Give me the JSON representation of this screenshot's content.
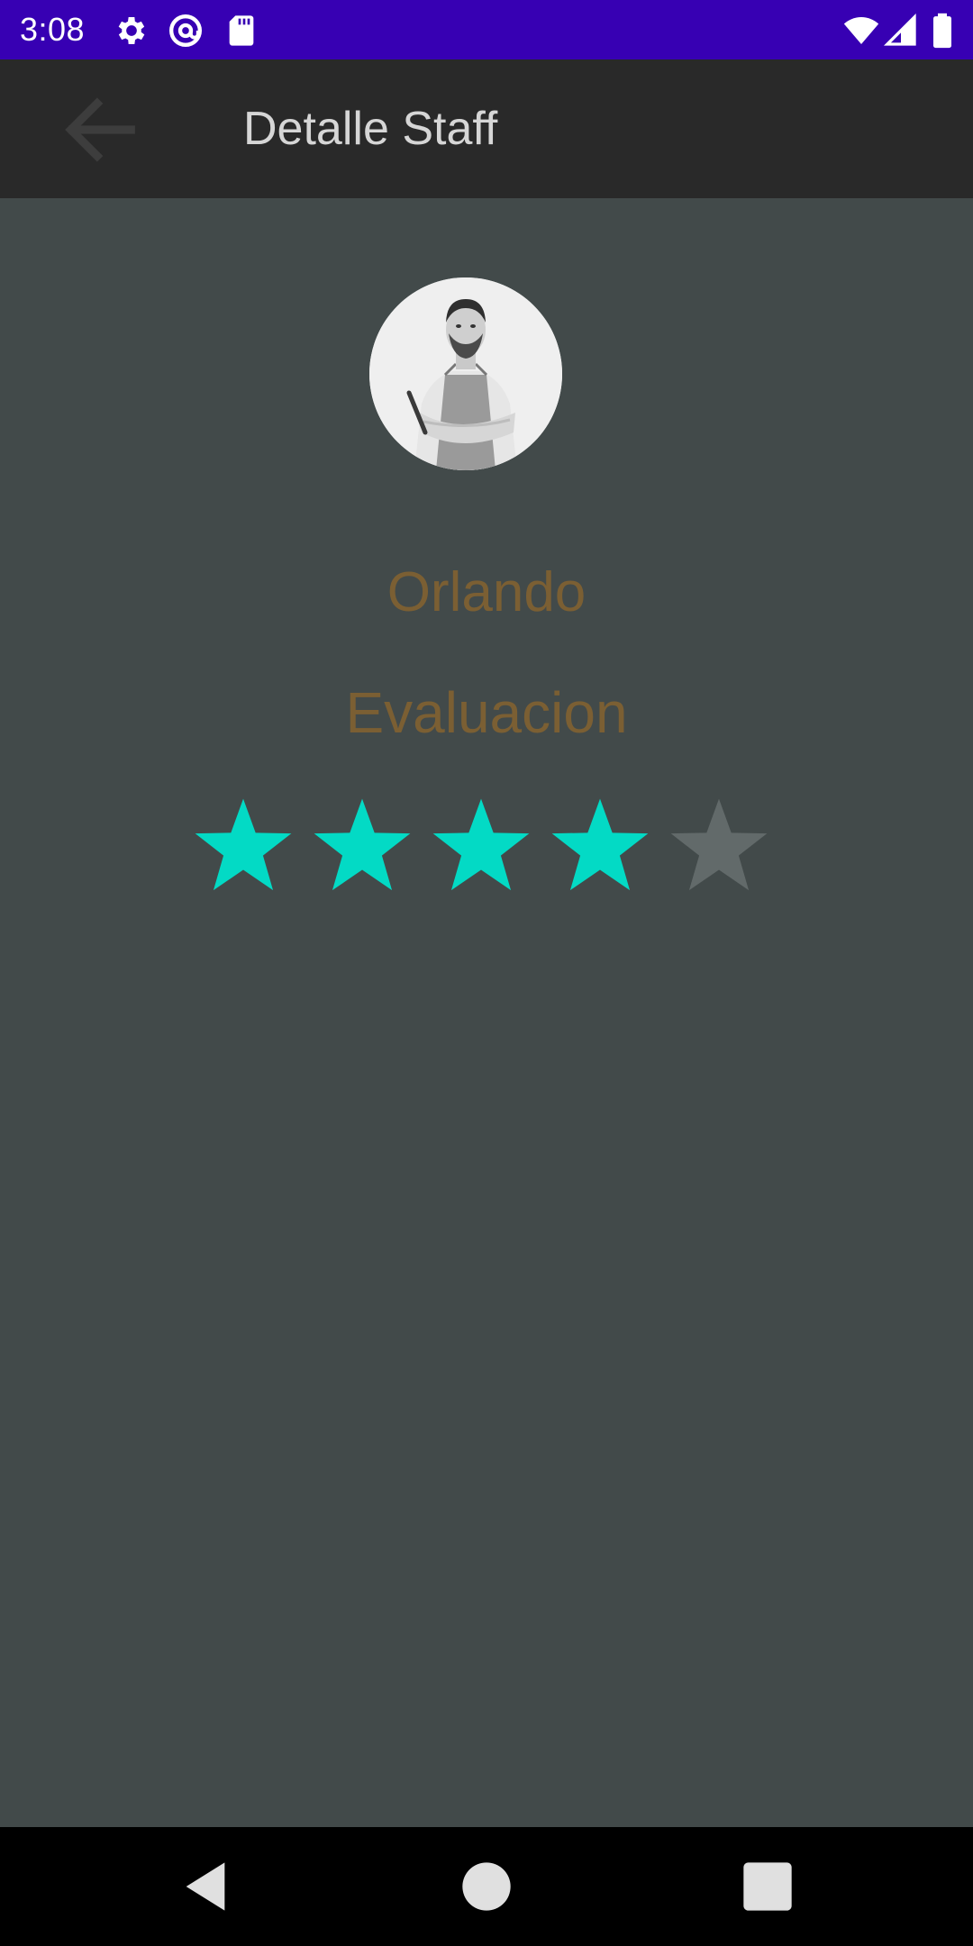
{
  "status_bar": {
    "time": "3:08",
    "left_icons": [
      "gear-icon",
      "at-sign-icon",
      "sd-card-icon"
    ],
    "right_icons": [
      "wifi-icon",
      "cellular-signal-icon",
      "battery-icon"
    ],
    "background": "#3700b3"
  },
  "app_bar": {
    "title": "Detalle Staff",
    "back_icon": "arrow-back-icon",
    "background": "#292929"
  },
  "staff": {
    "avatar": "staff-photo",
    "name": "Orlando",
    "evaluation_label": "Evaluacion",
    "rating": 4,
    "rating_max": 5
  },
  "colors": {
    "content_background": "#424a4a",
    "text_accent": "#7b5f33",
    "star_filled": "#03dac5",
    "star_empty": "#626a6a"
  },
  "nav_bar": {
    "buttons": [
      "back-triangle-icon",
      "home-circle-icon",
      "recents-square-icon"
    ]
  }
}
